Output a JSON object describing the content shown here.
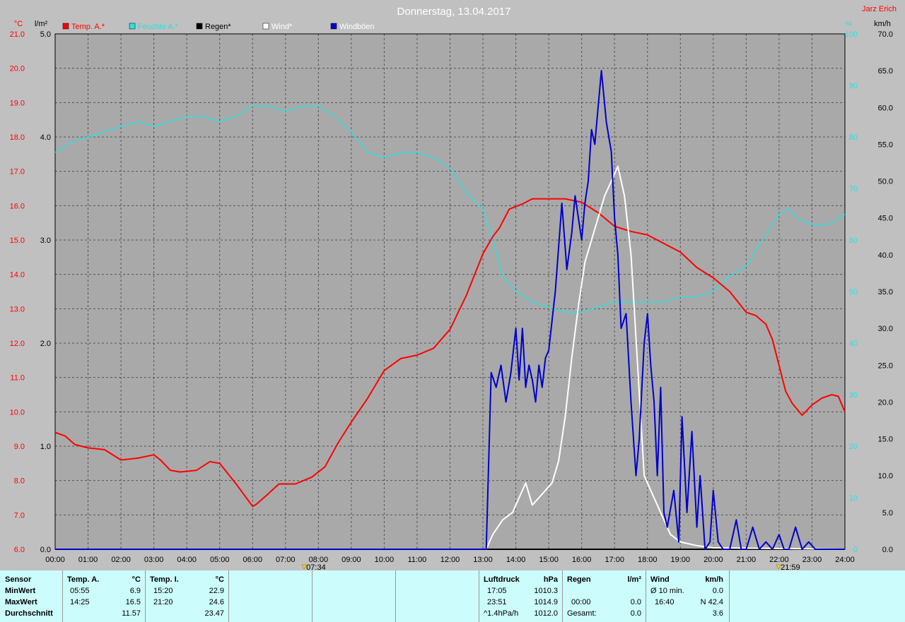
{
  "chart_data": {
    "type": "line",
    "title": "Donnerstag, 13.04.2017",
    "author": "Jarz Erich",
    "x_range": [
      "00:00",
      "24:00"
    ],
    "x_ticks": [
      "00:00",
      "01:00",
      "02:00",
      "03:00",
      "04:00",
      "05:00",
      "06:00",
      "07:00",
      "08:00",
      "09:00",
      "10:00",
      "11:00",
      "12:00",
      "13:00",
      "14:00",
      "15:00",
      "16:00",
      "17:00",
      "18:00",
      "19:00",
      "20:00",
      "21:00",
      "22:00",
      "23:00",
      "24:00"
    ],
    "sunrise": "07:34",
    "sunset": "21:59",
    "axes": {
      "temp": {
        "unit": "°C",
        "range": [
          6.0,
          21.0
        ],
        "ticks": [
          "6.0",
          "7.0",
          "8.0",
          "9.0",
          "10.0",
          "11.0",
          "12.0",
          "13.0",
          "14.0",
          "15.0",
          "16.0",
          "17.0",
          "18.0",
          "19.0",
          "20.0",
          "21.0"
        ],
        "color": "#ff0000"
      },
      "rain": {
        "unit": "l/m²",
        "range": [
          0.0,
          5.0
        ],
        "ticks": [
          "0.0",
          "1.0",
          "2.0",
          "3.0",
          "4.0",
          "5.0"
        ]
      },
      "humidity": {
        "unit": "%",
        "range": [
          0,
          100
        ],
        "ticks": [
          "0",
          "10",
          "20",
          "30",
          "40",
          "50",
          "60",
          "70",
          "80",
          "90",
          "100"
        ],
        "color": "#33dddd"
      },
      "wind": {
        "unit": "km/h",
        "range": [
          0.0,
          70.0
        ],
        "ticks": [
          "0.0",
          "5.0",
          "10.0",
          "15.0",
          "20.0",
          "25.0",
          "30.0",
          "35.0",
          "40.0",
          "45.0",
          "50.0",
          "55.0",
          "60.0",
          "65.0",
          "70.0"
        ]
      }
    },
    "legend": [
      {
        "name": "Temp. A.*",
        "color": "#ff0000"
      },
      {
        "name": "Feuchte A.*",
        "color": "#33dddd"
      },
      {
        "name": "Regen*",
        "color": "#000000"
      },
      {
        "name": "Wind*",
        "color": "#ffffff"
      },
      {
        "name": "Windböen",
        "color": "#0000cc"
      }
    ],
    "grid": true,
    "series": [
      {
        "name": "Temp. A.*",
        "axis": "temp",
        "color": "#ff0000",
        "x": [
          0,
          0.3,
          0.6,
          1,
          1.5,
          2,
          2.5,
          3,
          3.2,
          3.5,
          3.8,
          4.3,
          4.7,
          5,
          5.5,
          6,
          6.1,
          6.4,
          6.8,
          7.3,
          7.8,
          8.2,
          8.6,
          9,
          9.5,
          10,
          10.5,
          11,
          11.5,
          12,
          12.5,
          13,
          13.3,
          13.5,
          13.8,
          14.2,
          14.5,
          15,
          15.5,
          16,
          16.5,
          17,
          17.5,
          18,
          18.5,
          19,
          19.5,
          20,
          20.5,
          21,
          21.3,
          21.6,
          21.8,
          22.2,
          22.4,
          22.7,
          23,
          23.3,
          23.6,
          23.8,
          24
        ],
        "y": [
          9.4,
          9.3,
          9.05,
          8.95,
          8.9,
          8.6,
          8.65,
          8.75,
          8.6,
          8.3,
          8.25,
          8.3,
          8.55,
          8.5,
          7.9,
          7.25,
          7.3,
          7.55,
          7.9,
          7.9,
          8.1,
          8.4,
          9.1,
          9.7,
          10.4,
          11.2,
          11.55,
          11.65,
          11.85,
          12.4,
          13.4,
          14.6,
          15.1,
          15.35,
          15.9,
          16.05,
          16.2,
          16.2,
          16.2,
          16.1,
          15.8,
          15.4,
          15.25,
          15.15,
          14.9,
          14.65,
          14.2,
          13.9,
          13.5,
          12.9,
          12.8,
          12.55,
          12.1,
          10.6,
          10.25,
          9.9,
          10.2,
          10.4,
          10.5,
          10.45,
          10.0
        ]
      },
      {
        "name": "Feuchte A.*",
        "axis": "humidity",
        "color": "#33dddd",
        "x": [
          0,
          0.5,
          1,
          1.5,
          2,
          2.5,
          3,
          3.5,
          4,
          4.5,
          5,
          5.5,
          6,
          6.5,
          7,
          7.5,
          8,
          8.5,
          9,
          9.5,
          10,
          10.5,
          11,
          11.5,
          12,
          12.5,
          13,
          13.3,
          13.6,
          14,
          14.5,
          15,
          15.5,
          16,
          16.5,
          17,
          17.5,
          18,
          18.5,
          19,
          19.5,
          20,
          20.5,
          21,
          21.5,
          22,
          22.3,
          22.6,
          23,
          23.5,
          24
        ],
        "y": [
          77,
          79,
          80,
          81,
          82,
          83,
          82,
          83,
          84,
          84,
          83,
          84,
          86,
          86,
          85,
          86,
          86,
          84,
          81,
          77,
          76,
          77,
          77,
          76,
          74,
          69,
          66,
          60,
          53,
          50,
          48,
          47,
          46,
          46,
          47,
          48,
          48,
          48,
          48,
          49,
          49,
          50,
          53,
          55,
          60,
          65,
          66,
          64,
          63,
          63,
          65
        ]
      },
      {
        "name": "Wind*",
        "axis": "wind",
        "color": "#ffffff",
        "x": [
          0,
          13.1,
          13.3,
          13.6,
          13.9,
          14.1,
          14.3,
          14.5,
          14.7,
          14.9,
          15.1,
          15.3,
          15.5,
          15.7,
          15.9,
          16.1,
          16.3,
          16.5,
          16.7,
          16.9,
          17.1,
          17.3,
          17.5,
          17.7,
          17.9,
          18.1,
          18.3,
          18.5,
          18.7,
          19,
          19.5,
          20,
          24
        ],
        "y": [
          0,
          0,
          2,
          4,
          5,
          7,
          9,
          6,
          7,
          8,
          9,
          12,
          18,
          26,
          33,
          39,
          42,
          45,
          48,
          50,
          52,
          48,
          40,
          25,
          10,
          8,
          6,
          4,
          2,
          1,
          0.5,
          0.2,
          0
        ]
      },
      {
        "name": "Windböen",
        "axis": "wind",
        "color": "#0000cc",
        "x": [
          0,
          13.1,
          13.25,
          13.4,
          13.55,
          13.7,
          13.85,
          14,
          14.1,
          14.2,
          14.3,
          14.4,
          14.5,
          14.6,
          14.7,
          14.8,
          14.9,
          15,
          15.2,
          15.4,
          15.55,
          15.7,
          15.8,
          16,
          16.1,
          16.2,
          16.3,
          16.4,
          16.5,
          16.6,
          16.75,
          16.9,
          17,
          17.1,
          17.2,
          17.35,
          17.5,
          17.65,
          17.75,
          17.9,
          18,
          18.1,
          18.2,
          18.3,
          18.4,
          18.5,
          18.6,
          18.8,
          18.95,
          19.05,
          19.2,
          19.35,
          19.5,
          19.6,
          19.75,
          19.9,
          20,
          20.15,
          20.3,
          20.5,
          20.7,
          20.85,
          21,
          21.2,
          21.4,
          21.6,
          21.8,
          22,
          22.15,
          22.3,
          22.5,
          22.7,
          22.9,
          23.1,
          23.3,
          24
        ],
        "y": [
          0,
          0,
          24,
          22,
          25,
          20,
          24,
          30,
          23,
          30,
          22,
          25,
          23,
          20,
          25,
          22,
          26,
          27,
          35,
          47,
          38,
          43,
          48,
          42,
          47,
          50,
          57,
          55,
          60,
          65,
          58,
          54,
          45,
          40,
          30,
          32,
          20,
          10,
          15,
          28,
          32,
          25,
          20,
          10,
          22,
          5,
          3,
          8,
          1,
          18,
          5,
          16,
          3,
          10,
          0,
          1,
          8,
          1,
          0,
          0,
          4,
          0,
          0,
          3,
          0,
          1,
          0,
          2,
          0,
          0,
          3,
          0,
          1,
          0,
          0,
          0
        ]
      },
      {
        "name": "Regen*",
        "axis": "rain",
        "color": "#000000",
        "x": [
          0,
          24
        ],
        "y": [
          0,
          0
        ]
      }
    ]
  },
  "stats": {
    "sensor": {
      "header": "Sensor",
      "rows": [
        "MinWert",
        "MaxWert",
        "Durchschnitt"
      ]
    },
    "temp_a": {
      "header": "Temp. A.",
      "unit": "°C",
      "times": [
        "05:55",
        "14:25",
        ""
      ],
      "values": [
        "6.9",
        "16.5",
        "11.57"
      ]
    },
    "temp_i": {
      "header": "Temp. I.",
      "unit": "°C",
      "times": [
        "15:20",
        "21:20",
        ""
      ],
      "values": [
        "22.9",
        "24.6",
        "23.47"
      ]
    },
    "pressure": {
      "header": "Luftdruck",
      "unit": "hPa",
      "times": [
        "17:05",
        "23:51",
        "^1.4hPa/h"
      ],
      "values": [
        "1010.3",
        "1014.9",
        "1012.0"
      ]
    },
    "rain": {
      "header": "Regen",
      "unit": "l/m²",
      "times": [
        "",
        "00:00",
        "Gesamt:"
      ],
      "values": [
        "",
        "0.0",
        "0.0"
      ]
    },
    "wind": {
      "header": "Wind",
      "unit": "km/h",
      "times": [
        "Ø 10 min.",
        "16:40",
        ""
      ],
      "values": [
        "0.0",
        "N 42.4",
        "3.6"
      ]
    }
  }
}
